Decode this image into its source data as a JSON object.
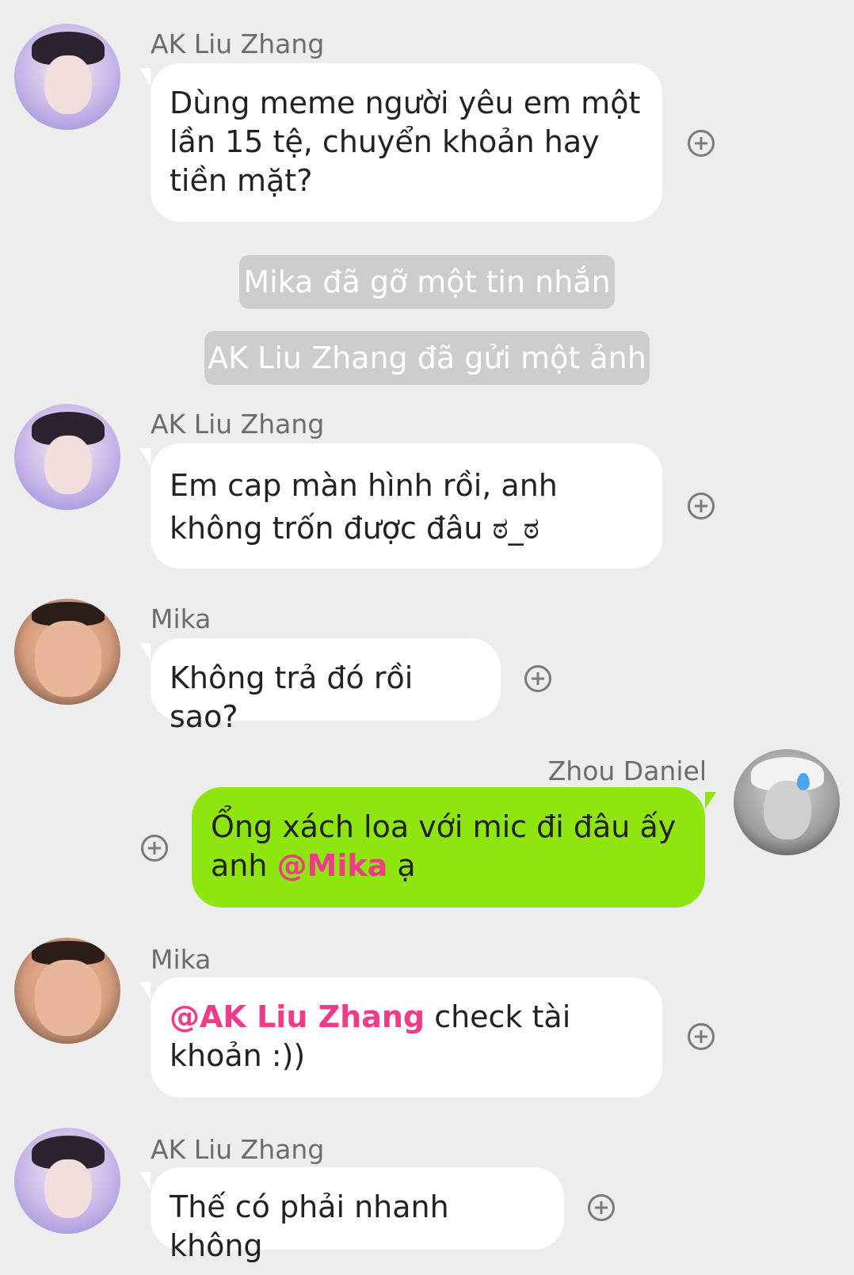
{
  "messages": [
    {
      "sender": "AK Liu Zhang",
      "text": "Dùng meme người yêu em một lần 15 tệ, chuyển khoản hay tiền mặt?"
    },
    {
      "sender": "AK Liu Zhang",
      "text": "Em cap màn hình rồi, anh không trốn được đâu ಠ_ಠ"
    },
    {
      "sender": "Mika",
      "text": "Không trả đó rồi sao?"
    },
    {
      "sender": "Zhou Daniel",
      "text_before": "Ổng xách loa với mic đi đâu ấy anh ",
      "mention": "@Mika",
      "text_after": " ạ"
    },
    {
      "sender": "Mika",
      "mention": "@AK Liu Zhang",
      "text_after": " check tài khoản :))"
    },
    {
      "sender": "AK Liu Zhang",
      "text": "Thế có phải nhanh không"
    }
  ],
  "notices": [
    "Mika đã gỡ một tin nhắn",
    "AK Liu Zhang đã gửi một ảnh"
  ],
  "colors": {
    "background": "#ededed",
    "incoming_bubble": "#ffffff",
    "outgoing_bubble": "#8fe510",
    "mention": "#f03a8a",
    "notice_bg": "#cdcdcd"
  },
  "icons": {
    "add": "plus-circle-icon",
    "sweat": "sweat-drop-icon"
  }
}
